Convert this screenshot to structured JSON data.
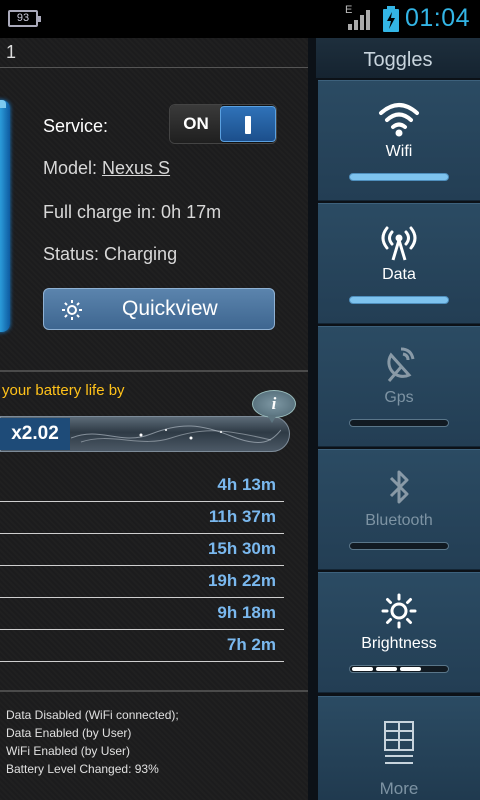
{
  "status_bar": {
    "battery_level": "93",
    "network_type": "E",
    "time": "01:04",
    "icons": [
      "battery-icon",
      "signal-icon",
      "charging-icon"
    ]
  },
  "main": {
    "header_text": "1",
    "service": {
      "label": "Service:",
      "toggle_state": "ON"
    },
    "model": {
      "label": "Model: ",
      "value": "Nexus S"
    },
    "full_charge": "Full charge in: 0h 17m",
    "status": "Status: Charging",
    "quickview_label": "Quickview",
    "extend_text": "your battery life by",
    "multiplier": "x2.02",
    "info_icon_text": "i",
    "times": [
      "4h 13m",
      "11h 37m",
      "15h 30m",
      "19h 22m",
      "9h 18m",
      "7h 2m"
    ],
    "log": [
      "Data Disabled (WiFi connected);",
      "Data Enabled (by User)",
      "WiFi Enabled (by User)",
      "Battery Level Changed: 93%"
    ]
  },
  "toggles": {
    "title": "Toggles",
    "items": [
      {
        "label": "Wifi",
        "icon": "wifi-icon",
        "state": "on"
      },
      {
        "label": "Data",
        "icon": "data-antenna-icon",
        "state": "on"
      },
      {
        "label": "Gps",
        "icon": "gps-satellite-icon",
        "state": "off"
      },
      {
        "label": "Bluetooth",
        "icon": "bluetooth-icon",
        "state": "off"
      },
      {
        "label": "Brightness",
        "icon": "brightness-sun-icon",
        "state": "level",
        "level": 0.75
      }
    ],
    "more_label": "More",
    "more_icon": "grid-menu-icon"
  },
  "colors": {
    "accent_blue": "#33b5e5",
    "highlight_yellow": "#ffc21a",
    "time_blue": "#7ab8ee",
    "toggle_bg": "#2b4b63"
  }
}
